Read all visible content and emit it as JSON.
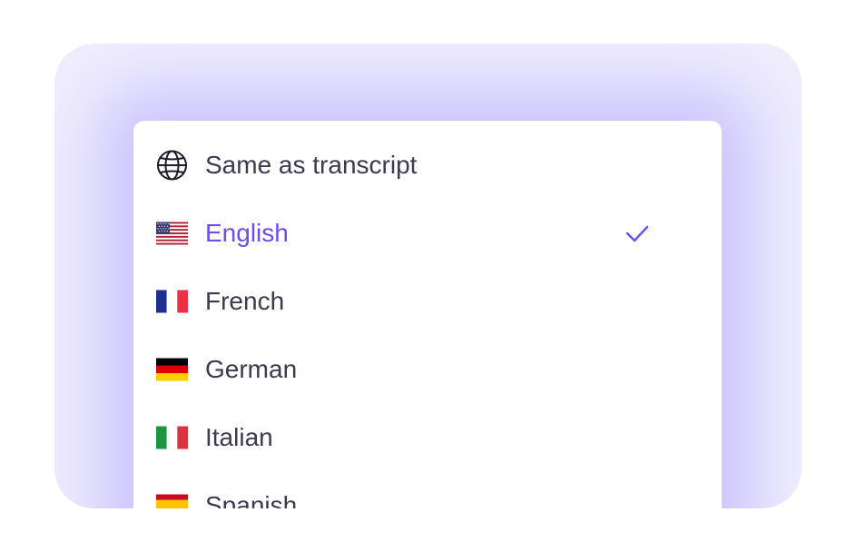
{
  "menu": {
    "items": [
      {
        "label": "Same as transcript",
        "icon": "globe-icon",
        "selected": false
      },
      {
        "label": "English",
        "icon": "us-flag-icon",
        "selected": true
      },
      {
        "label": "French",
        "icon": "france-flag-icon",
        "selected": false
      },
      {
        "label": "German",
        "icon": "germany-flag-icon",
        "selected": false
      },
      {
        "label": "Italian",
        "icon": "italy-flag-icon",
        "selected": false
      },
      {
        "label": "Spanish",
        "icon": "spain-flag-icon",
        "selected": false
      }
    ],
    "selected_icon": "check-icon"
  },
  "colors": {
    "accent": "#6d4cf2",
    "text": "#3b3a50",
    "panel_background": "#efedfd",
    "menu_background": "#ffffff"
  }
}
